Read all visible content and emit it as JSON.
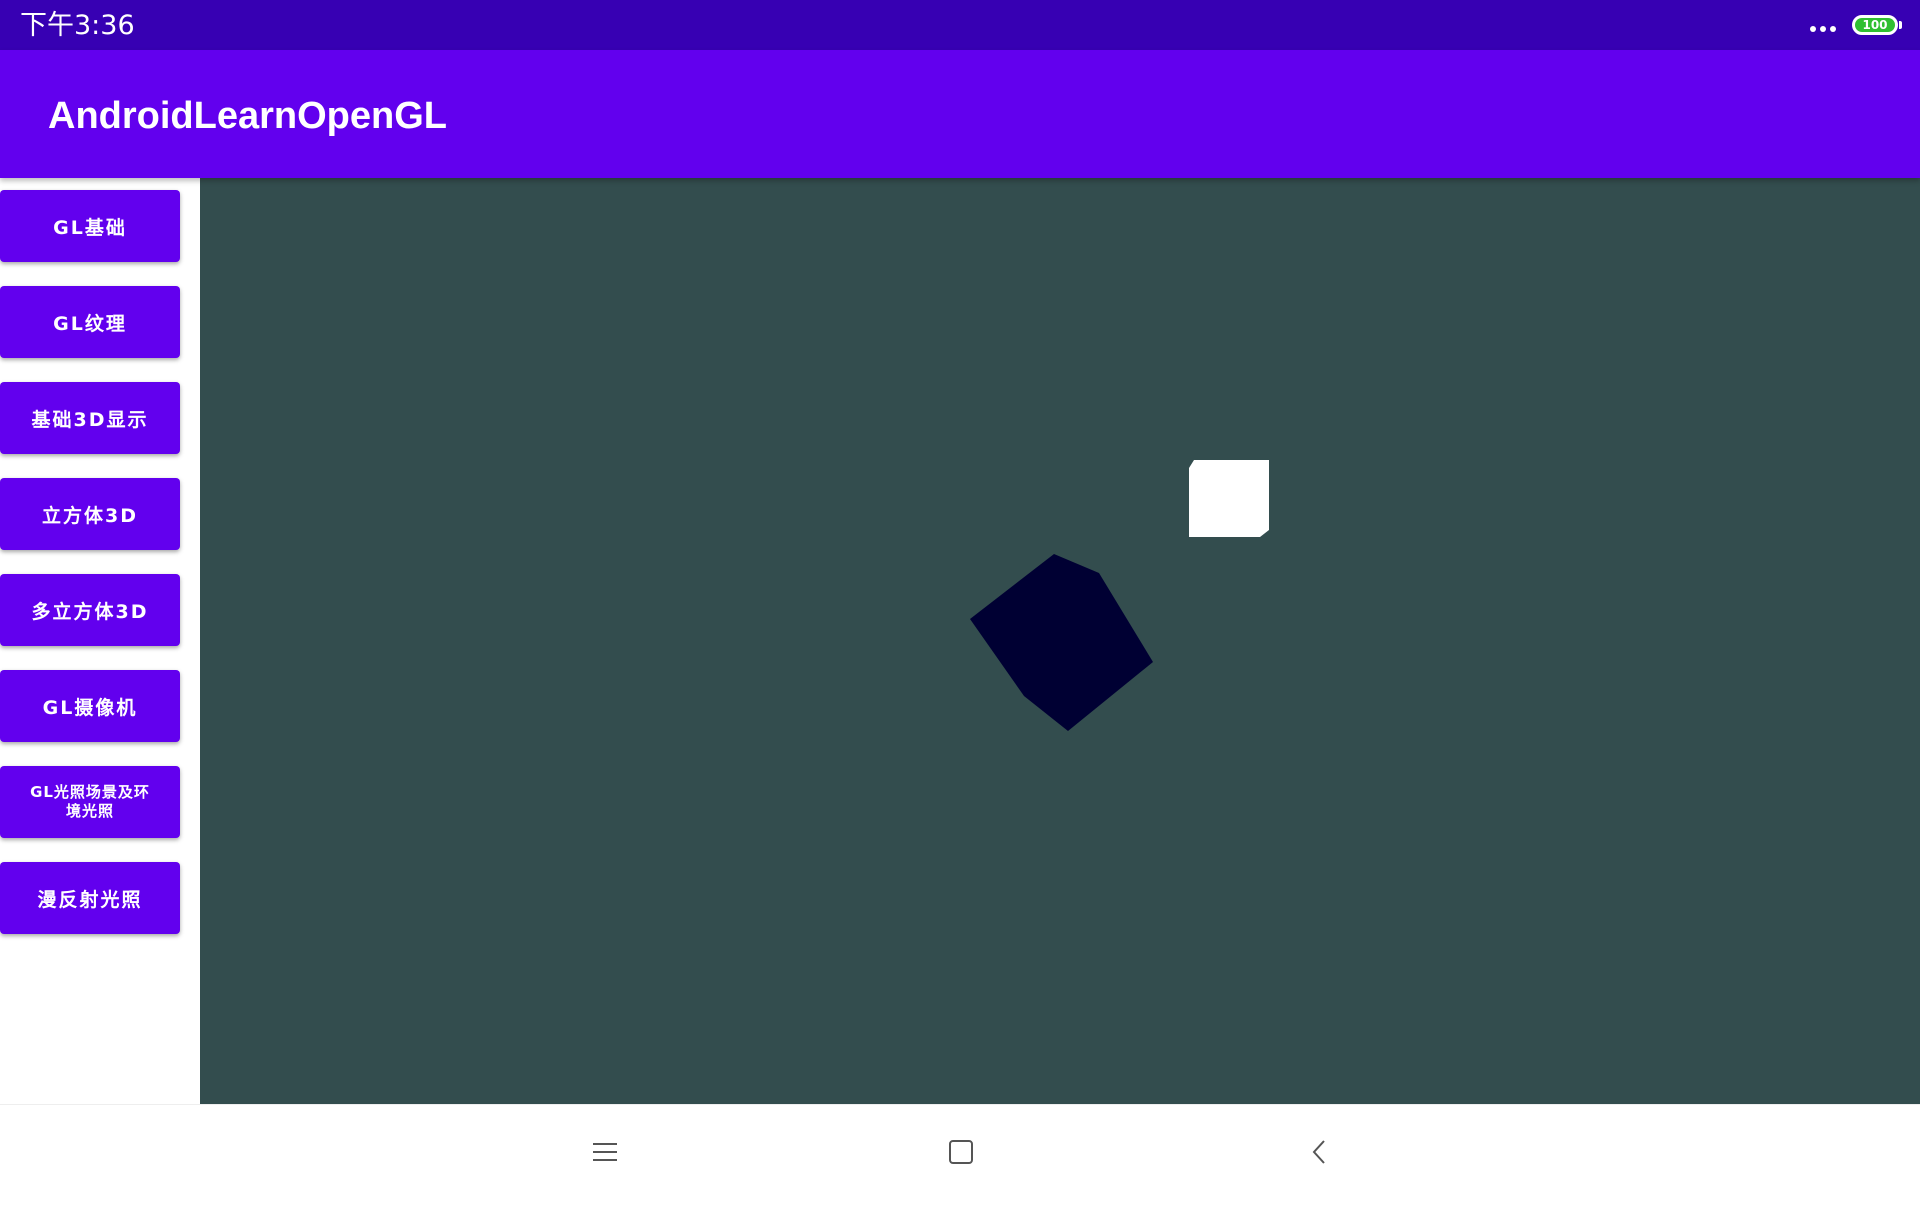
{
  "status_bar": {
    "time": "下午3:36",
    "battery_level": "100",
    "battery_fraction": 1.0,
    "icons": [
      "more-dots-icon",
      "battery-icon"
    ],
    "background": "#3700b3"
  },
  "app_bar": {
    "title": "AndroidLearnOpenGL",
    "background": "#6200ee"
  },
  "sidebar": {
    "items": [
      {
        "label": "GL基础"
      },
      {
        "label": "GL纹理"
      },
      {
        "label": "基础3D显示"
      },
      {
        "label": "立方体3D"
      },
      {
        "label": "多立方体3D"
      },
      {
        "label": "GL摄像机"
      },
      {
        "label": "GL光照场景及环境光照"
      },
      {
        "label": "漫反射光照"
      }
    ],
    "button_color": "#6200ee"
  },
  "gl_view": {
    "background": "#334d4e",
    "objects": [
      {
        "name": "light-source-cube",
        "color": "#ffffff"
      },
      {
        "name": "lit-cube",
        "color": "#000033"
      }
    ]
  },
  "nav_bar": {
    "icons": [
      "menu-icon",
      "home-icon",
      "back-icon"
    ]
  }
}
